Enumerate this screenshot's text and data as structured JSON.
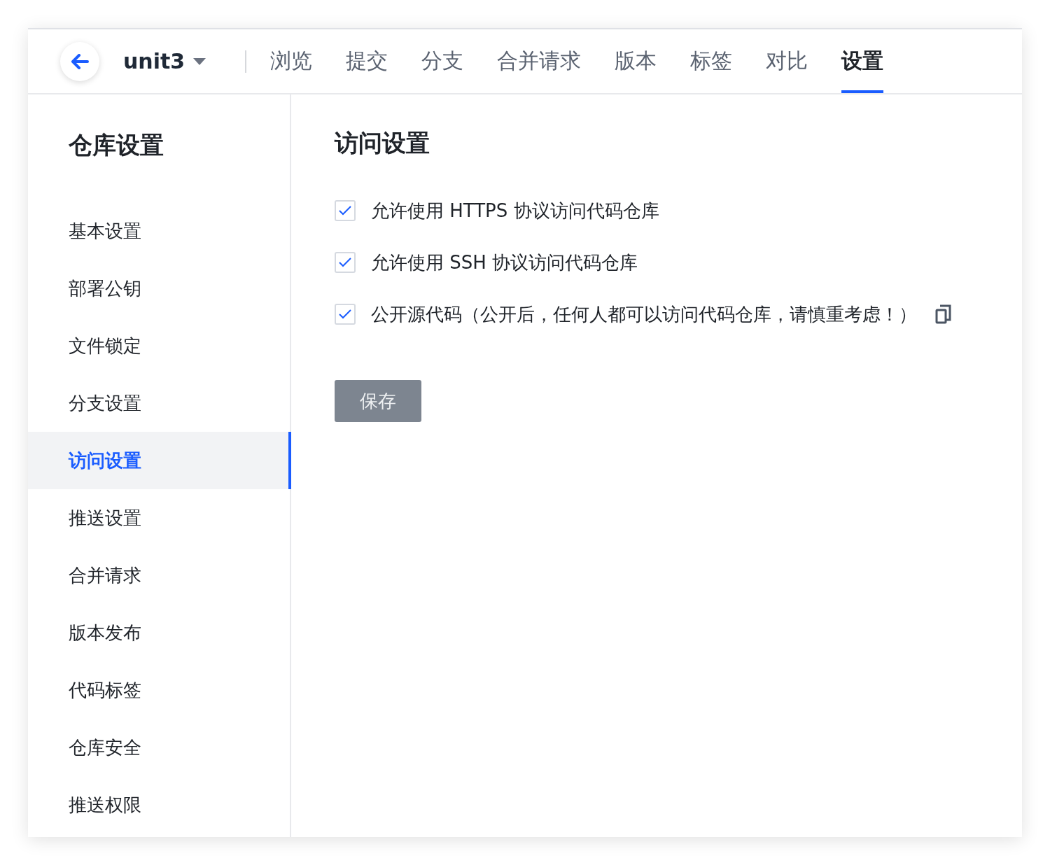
{
  "header": {
    "repo": "unit3",
    "tabs": [
      {
        "label": "浏览",
        "selected": false
      },
      {
        "label": "提交",
        "selected": false
      },
      {
        "label": "分支",
        "selected": false
      },
      {
        "label": "合并请求",
        "selected": false
      },
      {
        "label": "版本",
        "selected": false
      },
      {
        "label": "标签",
        "selected": false
      },
      {
        "label": "对比",
        "selected": false
      },
      {
        "label": "设置",
        "selected": true
      }
    ]
  },
  "sidebar": {
    "title": "仓库设置",
    "items": [
      {
        "label": "基本设置",
        "selected": false
      },
      {
        "label": "部署公钥",
        "selected": false
      },
      {
        "label": "文件锁定",
        "selected": false
      },
      {
        "label": "分支设置",
        "selected": false
      },
      {
        "label": "访问设置",
        "selected": true
      },
      {
        "label": "推送设置",
        "selected": false
      },
      {
        "label": "合并请求",
        "selected": false
      },
      {
        "label": "版本发布",
        "selected": false
      },
      {
        "label": "代码标签",
        "selected": false
      },
      {
        "label": "仓库安全",
        "selected": false
      },
      {
        "label": "推送权限",
        "selected": false
      }
    ]
  },
  "content": {
    "title": "访问设置",
    "options": [
      {
        "label": "允许使用 HTTPS 协议访问代码仓库",
        "checked": true,
        "info": false
      },
      {
        "label": "允许使用 SSH 协议访问代码仓库",
        "checked": true,
        "info": false
      },
      {
        "label": "公开源代码（公开后，任何人都可以访问代码仓库，请慎重考虑！）",
        "checked": true,
        "info": true
      }
    ],
    "save_button": {
      "label": "保存",
      "disabled": true
    }
  }
}
